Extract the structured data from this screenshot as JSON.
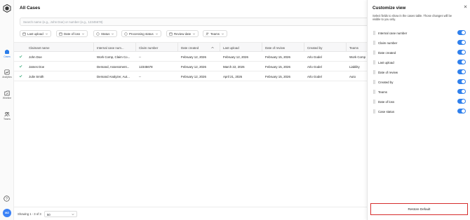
{
  "nav": {
    "items": [
      {
        "label": "Cases",
        "icon": "cases-icon"
      },
      {
        "label": "Analytics",
        "icon": "analytics-icon"
      },
      {
        "label": "Wireline",
        "icon": "wireline-icon"
      },
      {
        "label": "Teams",
        "icon": "teams-icon"
      }
    ],
    "avatar": "MZ"
  },
  "page": {
    "title": "All Cases",
    "search_placeholder": "Search name (e.g., John Doe) or number (e.g., 12345678)"
  },
  "filters": [
    "Last upload",
    "Date of loss",
    "Status",
    "Processing status",
    "Review date",
    "Teams"
  ],
  "table": {
    "columns": [
      "Claimant name",
      "Internal case num...",
      "Claim number",
      "Date created",
      "Last upload",
      "Date of review",
      "Created by",
      "Teams"
    ],
    "rows": [
      [
        "John Doe",
        "Work Comp, Claim Co...",
        "--",
        "February 12, 2026",
        "February 12, 2026",
        "February 15, 2026",
        "Arlo Godel",
        "Work Comp"
      ],
      [
        "James Doe",
        "Demand, Assessment...",
        "12345678",
        "February 12, 2026",
        "March 22, 2026",
        "February 15, 2026",
        "Arlo Godel",
        "Liability"
      ],
      [
        "Julie Smith",
        "Demand Analyzer, Aut...",
        "--",
        "February 12, 2026",
        "April 21, 2026",
        "February 15, 2026",
        "Arlo Godel",
        "Auto"
      ]
    ]
  },
  "footer": {
    "showing": "Showing 1 - 3 of 3",
    "page_size": "50"
  },
  "drawer": {
    "title": "Customize view",
    "description": "Select fields to show in the cases table. Those changes will be visible to you only.",
    "fields": [
      "Internal case number",
      "Claim number",
      "Date created",
      "Last upload",
      "Date of review",
      "Created by",
      "Teams",
      "Date of loss",
      "Case status"
    ],
    "restore_label": "Restore Default"
  },
  "colors": {
    "accent": "#2f80ed",
    "highlight_border": "#d62d2d",
    "check": "#22a06b"
  }
}
